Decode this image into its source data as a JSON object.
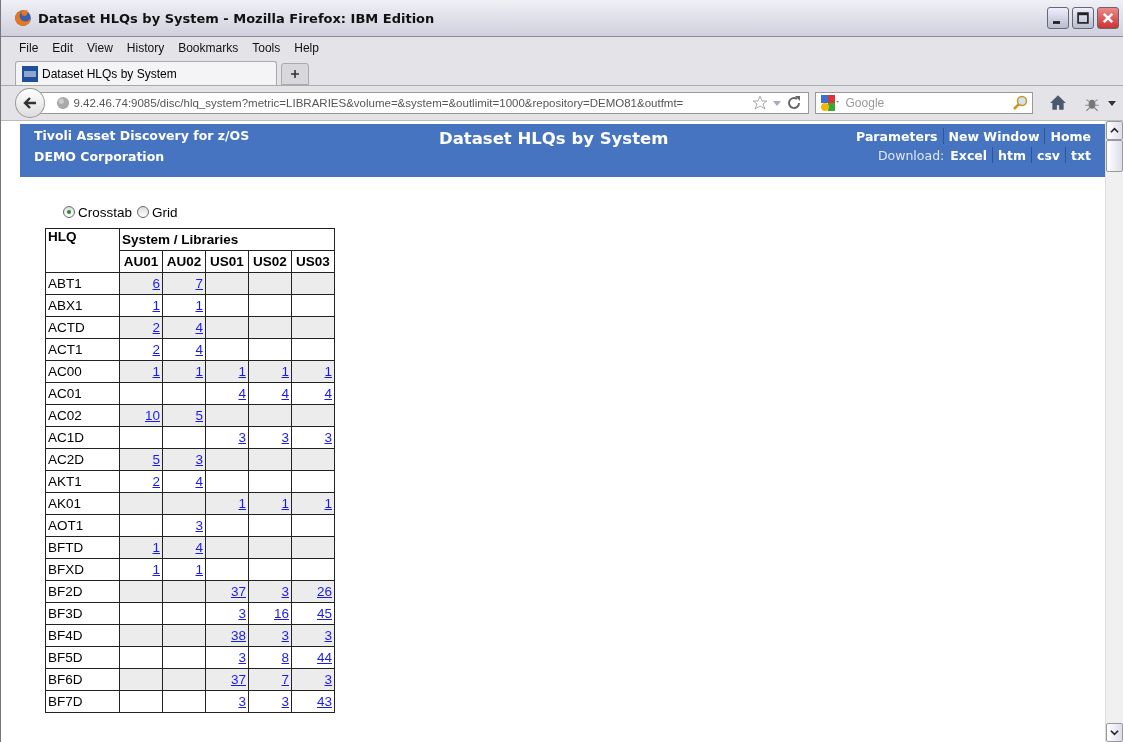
{
  "window": {
    "title": "Dataset HLQs by System - Mozilla Firefox: IBM Edition"
  },
  "menu": [
    "File",
    "Edit",
    "View",
    "History",
    "Bookmarks",
    "Tools",
    "Help"
  ],
  "tabs": [
    {
      "label": "Dataset HLQs by System",
      "selected": true
    }
  ],
  "address_bar": {
    "url": "9.42.46.74:9085/disc/hlq_system?metric=LIBRARIES&volume=&system=&outlimit=1000&repository=DEMO81&outfmt="
  },
  "search": {
    "placeholder": "Google"
  },
  "header": {
    "product": "Tivoli Asset Discovery for z/OS",
    "company": "DEMO Corporation",
    "title": "Dataset HLQs by System",
    "links": [
      "Parameters",
      "New Window",
      "Home"
    ],
    "download_label": "Download:",
    "downloads": [
      "Excel",
      "htm",
      "csv",
      "txt"
    ]
  },
  "view_options": [
    {
      "label": "Crosstab",
      "selected": true
    },
    {
      "label": "Grid",
      "selected": false
    }
  ],
  "table": {
    "row_header": "HLQ",
    "group_header": "System / Libraries",
    "columns": [
      "AU01",
      "AU02",
      "US01",
      "US02",
      "US03"
    ],
    "rows": [
      {
        "hlq": "ABT1",
        "cells": [
          "6",
          "7",
          null,
          null,
          null
        ]
      },
      {
        "hlq": "ABX1",
        "cells": [
          "1",
          "1",
          null,
          null,
          null
        ]
      },
      {
        "hlq": "ACTD",
        "cells": [
          "2",
          "4",
          null,
          null,
          null
        ]
      },
      {
        "hlq": "ACT1",
        "cells": [
          "2",
          "4",
          null,
          null,
          null
        ]
      },
      {
        "hlq": "AC00",
        "cells": [
          "1",
          "1",
          "1",
          "1",
          "1"
        ]
      },
      {
        "hlq": "AC01",
        "cells": [
          null,
          null,
          "4",
          "4",
          "4"
        ]
      },
      {
        "hlq": "AC02",
        "cells": [
          "10",
          "5",
          null,
          null,
          null
        ]
      },
      {
        "hlq": "AC1D",
        "cells": [
          null,
          null,
          "3",
          "3",
          "3"
        ]
      },
      {
        "hlq": "AC2D",
        "cells": [
          "5",
          "3",
          null,
          null,
          null
        ]
      },
      {
        "hlq": "AKT1",
        "cells": [
          "2",
          "4",
          null,
          null,
          null
        ]
      },
      {
        "hlq": "AK01",
        "cells": [
          null,
          null,
          "1",
          "1",
          "1"
        ]
      },
      {
        "hlq": "AOT1",
        "cells": [
          null,
          "3",
          null,
          null,
          null
        ]
      },
      {
        "hlq": "BFTD",
        "cells": [
          "1",
          "4",
          null,
          null,
          null
        ]
      },
      {
        "hlq": "BFXD",
        "cells": [
          "1",
          "1",
          null,
          null,
          null
        ]
      },
      {
        "hlq": "BF2D",
        "cells": [
          null,
          null,
          "37",
          "3",
          "26"
        ]
      },
      {
        "hlq": "BF3D",
        "cells": [
          null,
          null,
          "3",
          "16",
          "45"
        ]
      },
      {
        "hlq": "BF4D",
        "cells": [
          null,
          null,
          "38",
          "3",
          "3"
        ]
      },
      {
        "hlq": "BF5D",
        "cells": [
          null,
          null,
          "3",
          "8",
          "44"
        ]
      },
      {
        "hlq": "BF6D",
        "cells": [
          null,
          null,
          "37",
          "7",
          "3"
        ]
      },
      {
        "hlq": "BF7D",
        "cells": [
          null,
          null,
          "3",
          "3",
          "43"
        ]
      }
    ]
  }
}
